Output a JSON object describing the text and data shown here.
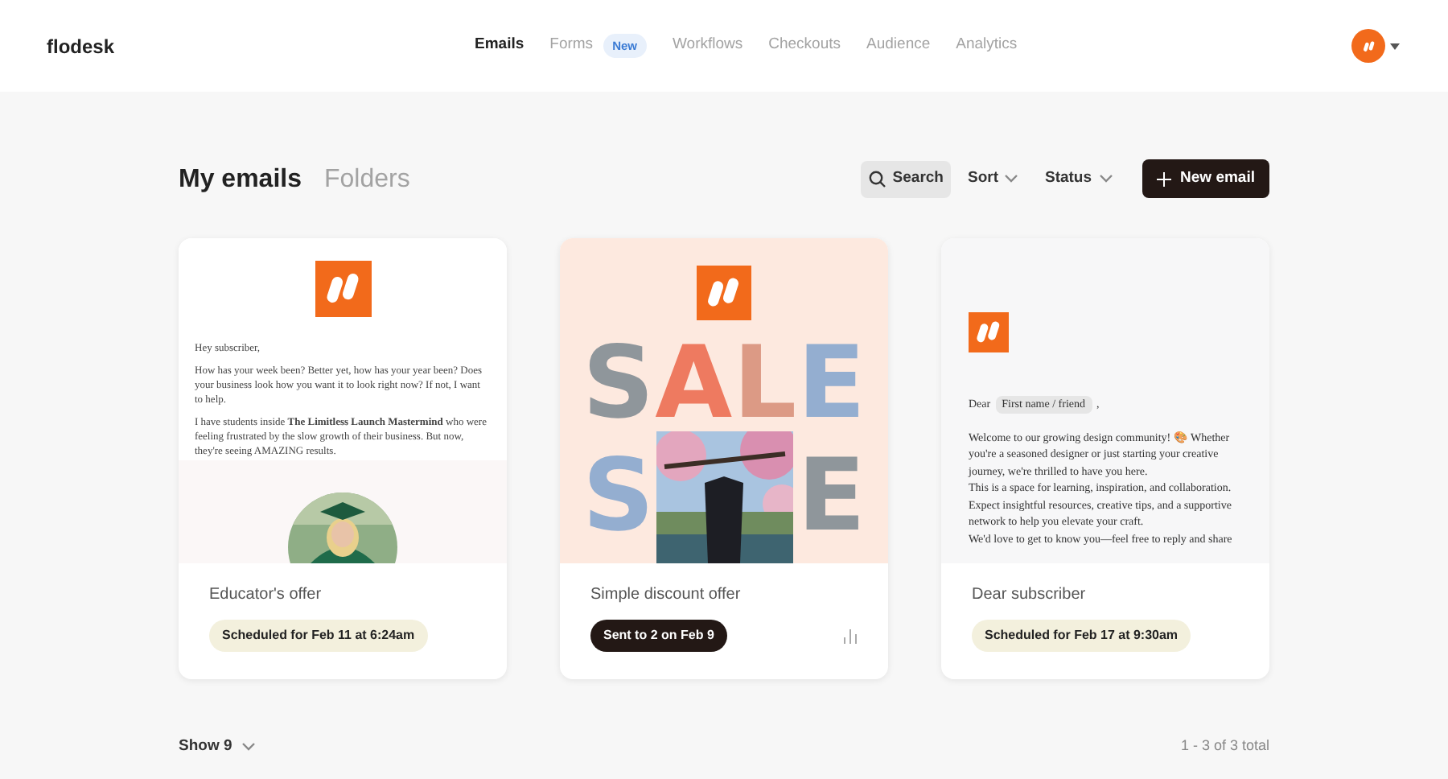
{
  "brand": "flodesk",
  "nav": [
    {
      "label": "Emails",
      "selected": true
    },
    {
      "label": "Forms",
      "selected": false,
      "badge": "New"
    },
    {
      "label": "Workflows",
      "selected": false
    },
    {
      "label": "Checkouts",
      "selected": false
    },
    {
      "label": "Audience",
      "selected": false
    },
    {
      "label": "Analytics",
      "selected": false
    }
  ],
  "page_tabs": [
    {
      "label": "My emails",
      "selected": true
    },
    {
      "label": "Folders",
      "selected": false
    }
  ],
  "toolbar": {
    "search": "Search",
    "sort": "Sort",
    "status": "Status",
    "new_email": "New email"
  },
  "emails": [
    {
      "preview": {
        "kind": "letter",
        "greeting": "Hey subscriber,",
        "paragraphs": [
          "How has your week been? Better yet, how has your year been? Does your business look how you want it to look right now? If not, I want to help.",
          "I have students inside **The Limitless Launch Mastermind** who were feeling frustrated by the slow growth of their business. But now, they're seeing AMAZING results."
        ]
      },
      "name": "Educator's offer",
      "status": {
        "kind": "scheduled",
        "label": "Scheduled for Feb 11 at 6:24am"
      },
      "stats": false
    },
    {
      "preview": {
        "kind": "sale",
        "letters_top": [
          {
            "char": "S",
            "color": "#8f969b"
          },
          {
            "char": "A",
            "color": "#ee7a60"
          },
          {
            "char": "L",
            "color": "#dc9a85"
          },
          {
            "char": "E",
            "color": "#94aed0"
          }
        ],
        "letters_bottom": [
          {
            "char": "S",
            "color": "#94aed0"
          },
          {
            "char": "E",
            "color": "#8f969b"
          }
        ]
      },
      "name": "Simple discount offer",
      "status": {
        "kind": "sent",
        "label": "Sent to 2 on Feb 9"
      },
      "stats": true
    },
    {
      "preview": {
        "kind": "welcome",
        "greeting": "Dear",
        "merge_tag": "First name / friend",
        "punct": ",",
        "paragraphs": [
          "Welcome to our growing design community! 🎨 Whether you're a seasoned designer or just starting your creative journey, we're thrilled to have you here.",
          "This is a space for learning, inspiration, and collaboration. Expect insightful resources, creative tips, and a supportive network to help you elevate your craft.",
          "We'd love to get to know you—feel free to reply and share"
        ]
      },
      "name": "Dear subscriber",
      "status": {
        "kind": "scheduled",
        "label": "Scheduled for Feb 17 at 9:30am"
      },
      "stats": false
    }
  ],
  "footer": {
    "show": "Show 9",
    "total": "1 - 3 of 3 total"
  }
}
